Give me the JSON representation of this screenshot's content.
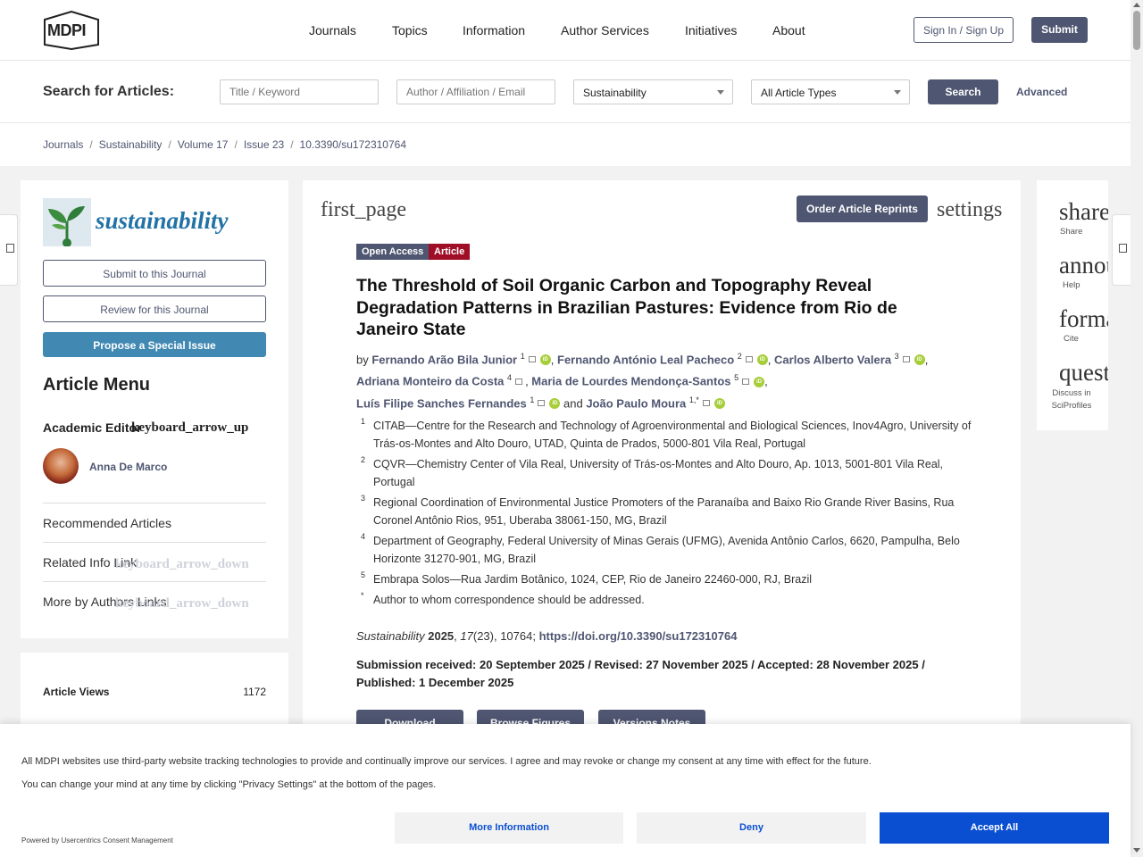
{
  "header": {
    "logo": "MDPI",
    "nav": [
      "Journals",
      "Topics",
      "Information",
      "Author Services",
      "Initiatives",
      "About"
    ],
    "sign_in": "Sign In / Sign Up",
    "submit": "Submit"
  },
  "search": {
    "label": "Search for Articles:",
    "title_placeholder": "Title / Keyword",
    "author_placeholder": "Author / Affiliation / Email",
    "journal_select": "Sustainability",
    "type_select": "All Article Types",
    "button": "Search",
    "advanced": "Advanced"
  },
  "breadcrumb": [
    "Journals",
    "Sustainability",
    "Volume 17",
    "Issue 23",
    "10.3390/su172310764"
  ],
  "sidebar": {
    "journal_name": "sustainability",
    "submit_journal": "Submit to this Journal",
    "review_journal": "Review for this Journal",
    "propose_issue": "Propose a Special Issue",
    "article_menu": "Article Menu",
    "academic_editor": "Academic Editor",
    "academic_arrow": "keyboard_arrow_up",
    "editor_name": "Anna De Marco",
    "recommended": "Recommended Articles",
    "related": "Related Info Link",
    "related_arrow": "keyboard_arrow_down",
    "more_authors": "More by Authors Links",
    "more_arrow": "keyboard_arrow_down",
    "views_label": "Article Views",
    "views_value": "1172"
  },
  "article": {
    "first_page": "first_page",
    "reprints": "Order Article Reprints",
    "settings": "settings",
    "badge_open": "Open Access",
    "badge_type": "Article",
    "title": "The Threshold of Soil Organic Carbon and Topography Reveal Degradation Patterns in Brazilian Pastures: Evidence from Rio de Janeiro State",
    "by": "by",
    "and": "and",
    "authors": [
      {
        "name": "Fernando Arão Bila Junior",
        "sup": "1"
      },
      {
        "name": "Fernando António Leal Pacheco",
        "sup": "2"
      },
      {
        "name": "Carlos Alberto Valera",
        "sup": "3"
      },
      {
        "name": "Adriana Monteiro da Costa",
        "sup": "4"
      },
      {
        "name": "Maria de Lourdes Mendonça-Santos",
        "sup": "5"
      },
      {
        "name": "Luís Filipe Sanches Fernandes",
        "sup": "1"
      },
      {
        "name": "João Paulo Moura",
        "sup": "1,*"
      }
    ],
    "affiliations": [
      {
        "num": "1",
        "text": "CITAB—Centre for the Research and Technology of Agroenvironmental and Biological Sciences, Inov4Agro, University of Trás-os-Montes and Alto Douro, UTAD, Quinta de Prados, 5000-801 Vila Real, Portugal"
      },
      {
        "num": "2",
        "text": "CQVR—Chemistry Center of Vila Real, University of Trás-os-Montes and Alto Douro, Ap. 1013, 5001-801 Vila Real, Portugal"
      },
      {
        "num": "3",
        "text": "Regional Coordination of Environmental Justice Promoters of the Paranaíba and Baixo Rio Grande River Basins, Rua Coronel Antônio Rios, 951, Uberaba 38061-150, MG, Brazil"
      },
      {
        "num": "4",
        "text": "Department of Geography, Federal University of Minas Gerais (UFMG), Avenida Antônio Carlos, 6620, Pampulha, Belo Horizonte 31270-901, MG, Brazil"
      },
      {
        "num": "5",
        "text": "Embrapa Solos—Rua Jardim Botânico, 1024, CEP, Rio de Janeiro 22460-000, RJ, Brazil"
      },
      {
        "num": "*",
        "text": "Author to whom correspondence should be addressed."
      }
    ],
    "journal": "Sustainability",
    "year": "2025",
    "volume": "17",
    "issue_num": "(23), 10764;",
    "doi": "https://doi.org/10.3390/su172310764",
    "dates": "Submission received: 20 September 2025 / Revised: 27 November 2025 / Accepted: 28 November 2025 / Published: 1 December 2025",
    "download": "Download",
    "download_icon": "arrow_down",
    "browse": "Browse Figures",
    "versions": "Versions Notes"
  },
  "rail": {
    "share_icon": "share",
    "share": "Share",
    "help_icon": "announcement",
    "help": "Help",
    "cite_icon": "format_quote",
    "cite": "Cite",
    "discuss_icon": "question_answer",
    "discuss": "Discuss in SciProfiles"
  },
  "cookie": {
    "line1": "All MDPI websites use third-party website tracking technologies to provide and continually improve our services. I agree and may revoke or change my consent at any time with effect for the future.",
    "line2": "You can change your mind at any time by clicking \"Privacy Settings\" at the bottom of the pages.",
    "powered": "Powered by Usercentrics Consent Management",
    "more_info": "More Information",
    "deny": "Deny",
    "accept": "Accept All"
  },
  "colors": {
    "primary": "#4f5671",
    "propose": "#4189b3",
    "accept": "#0a4fd2",
    "article_badge": "#a00d26",
    "orcid": "#a6ce39"
  }
}
